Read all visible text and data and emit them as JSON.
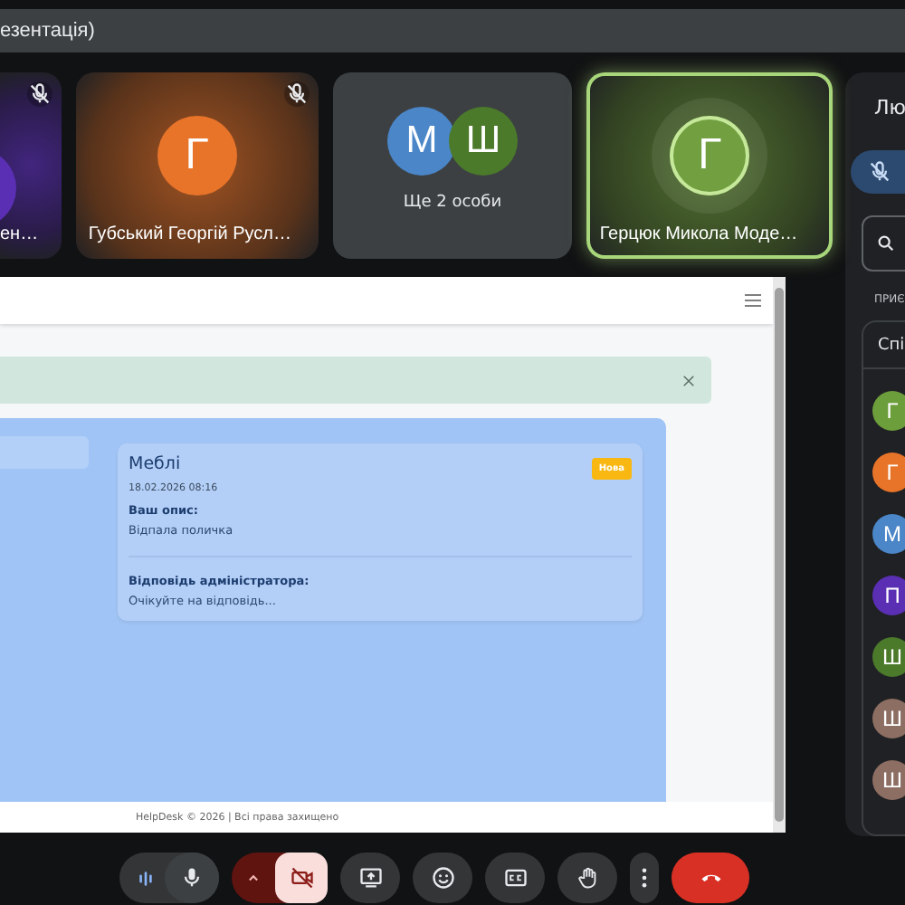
{
  "top_bar": {
    "title": "езентація)"
  },
  "tiles": [
    {
      "kind": "person",
      "name": "ен…",
      "muted": true,
      "color": "#5a2fb4"
    },
    {
      "kind": "person",
      "name": "Губський Георгій Русл…",
      "initial": "Г",
      "muted": true,
      "color": "#e8742a"
    },
    {
      "kind": "group",
      "label": "Ще 2 особи",
      "avatars": [
        {
          "initial": "М",
          "color": "#4a86c8"
        },
        {
          "initial": "Ш",
          "color": "#4b7a2b"
        }
      ]
    },
    {
      "kind": "person",
      "name": "Герцюк Микола Моде…",
      "initial": "Г",
      "muted": false,
      "speaking": true,
      "color": "#72a040"
    }
  ],
  "presentation": {
    "alert": {
      "dismissible": true
    },
    "ticket": {
      "title": "Меблі",
      "date": "18.02.2026 08:16",
      "status": "Нова",
      "description_label": "Ваш опис:",
      "description": "Відпала поличка",
      "reply_label": "Відповідь адміністратора:",
      "reply": "Очікуйте на відповідь..."
    },
    "footer": "HelpDesk © 2026 | Всі права захищено"
  },
  "people_panel": {
    "title": "Лю",
    "mic_muted": true,
    "section": "ПРИЄ",
    "list_title": "Спі",
    "participants": [
      {
        "initial": "Г",
        "color": "#6d9e3c"
      },
      {
        "initial": "Г",
        "color": "#e8742a"
      },
      {
        "initial": "М",
        "color": "#4a86c8"
      },
      {
        "initial": "П",
        "color": "#5a2fb4"
      },
      {
        "initial": "Ш",
        "color": "#4b7a2b"
      },
      {
        "initial": "Ш",
        "color": "#8d6e63"
      },
      {
        "initial": "Ш",
        "color": "#8d6e63"
      }
    ]
  },
  "controls": [
    {
      "kind": "mic",
      "on": true
    },
    {
      "kind": "camera",
      "on": false
    },
    {
      "kind": "present"
    },
    {
      "kind": "emoji"
    },
    {
      "kind": "captions"
    },
    {
      "kind": "hand"
    },
    {
      "kind": "more"
    },
    {
      "kind": "leave"
    }
  ]
}
